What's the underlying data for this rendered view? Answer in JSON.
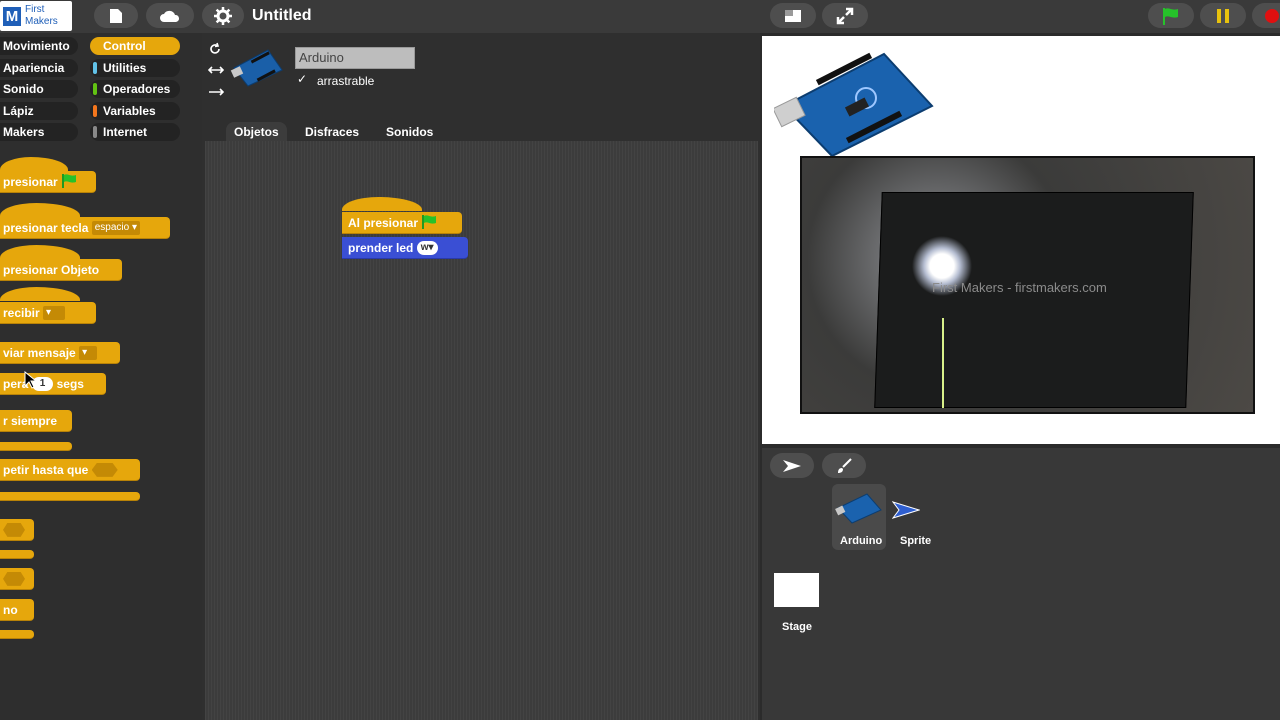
{
  "app": {
    "logo_letter": "M",
    "logo_text": "First Makers",
    "project_title": "Untitled"
  },
  "topbar": {
    "icons": [
      "file-icon",
      "cloud-icon",
      "gear-icon",
      "stage-size-icon",
      "fullscreen-icon",
      "green-flag-icon",
      "pause-icon",
      "stop-icon"
    ],
    "colors": {
      "flag": "#26c22a",
      "pause": "#e8c20d",
      "stop": "#e01010"
    }
  },
  "categories": {
    "left": [
      "Movimiento",
      "Apariencia",
      "Sonido",
      "Lápiz",
      "Makers"
    ],
    "right": [
      "Control",
      "Utilities",
      "Operadores",
      "Variables",
      "Internet"
    ],
    "selected": "Control",
    "colors": {
      "Movimiento": "#4a6cd4",
      "Apariencia": "#8a55d7",
      "Sonido": "#bb42c3",
      "Lápiz": "#0e9a6c",
      "Makers": "#1b9bd7",
      "Control": "#e6a70c",
      "Utilities": "#62c2e8",
      "Operadores": "#62c213",
      "Variables": "#f3761d",
      "Internet": "#888888"
    }
  },
  "palette_blocks": {
    "b1": "presionar",
    "b2": "presionar tecla",
    "b2_key": "espacio",
    "b3": "presionar Objeto",
    "b4": "recibir",
    "b5": "viar mensaje",
    "b6": "pera",
    "b6_value": "1",
    "b6_unit": "segs",
    "b7": "r siempre",
    "b8": "petir hasta que",
    "b9": "no"
  },
  "sprite": {
    "name": "Arduino",
    "draggable_label": "arrastrable",
    "draggable_checked": "✓"
  },
  "tabs": [
    "Objetos",
    "Disfraces",
    "Sonidos"
  ],
  "script": {
    "hat_label": "Al presionar",
    "command_label": "prender led",
    "command_value": "w"
  },
  "stage": {
    "photo_board_text": "First Makers - firstmakers.com"
  },
  "corral": {
    "sprites": [
      "Arduino",
      "Sprite"
    ],
    "stage_label": "Stage"
  }
}
